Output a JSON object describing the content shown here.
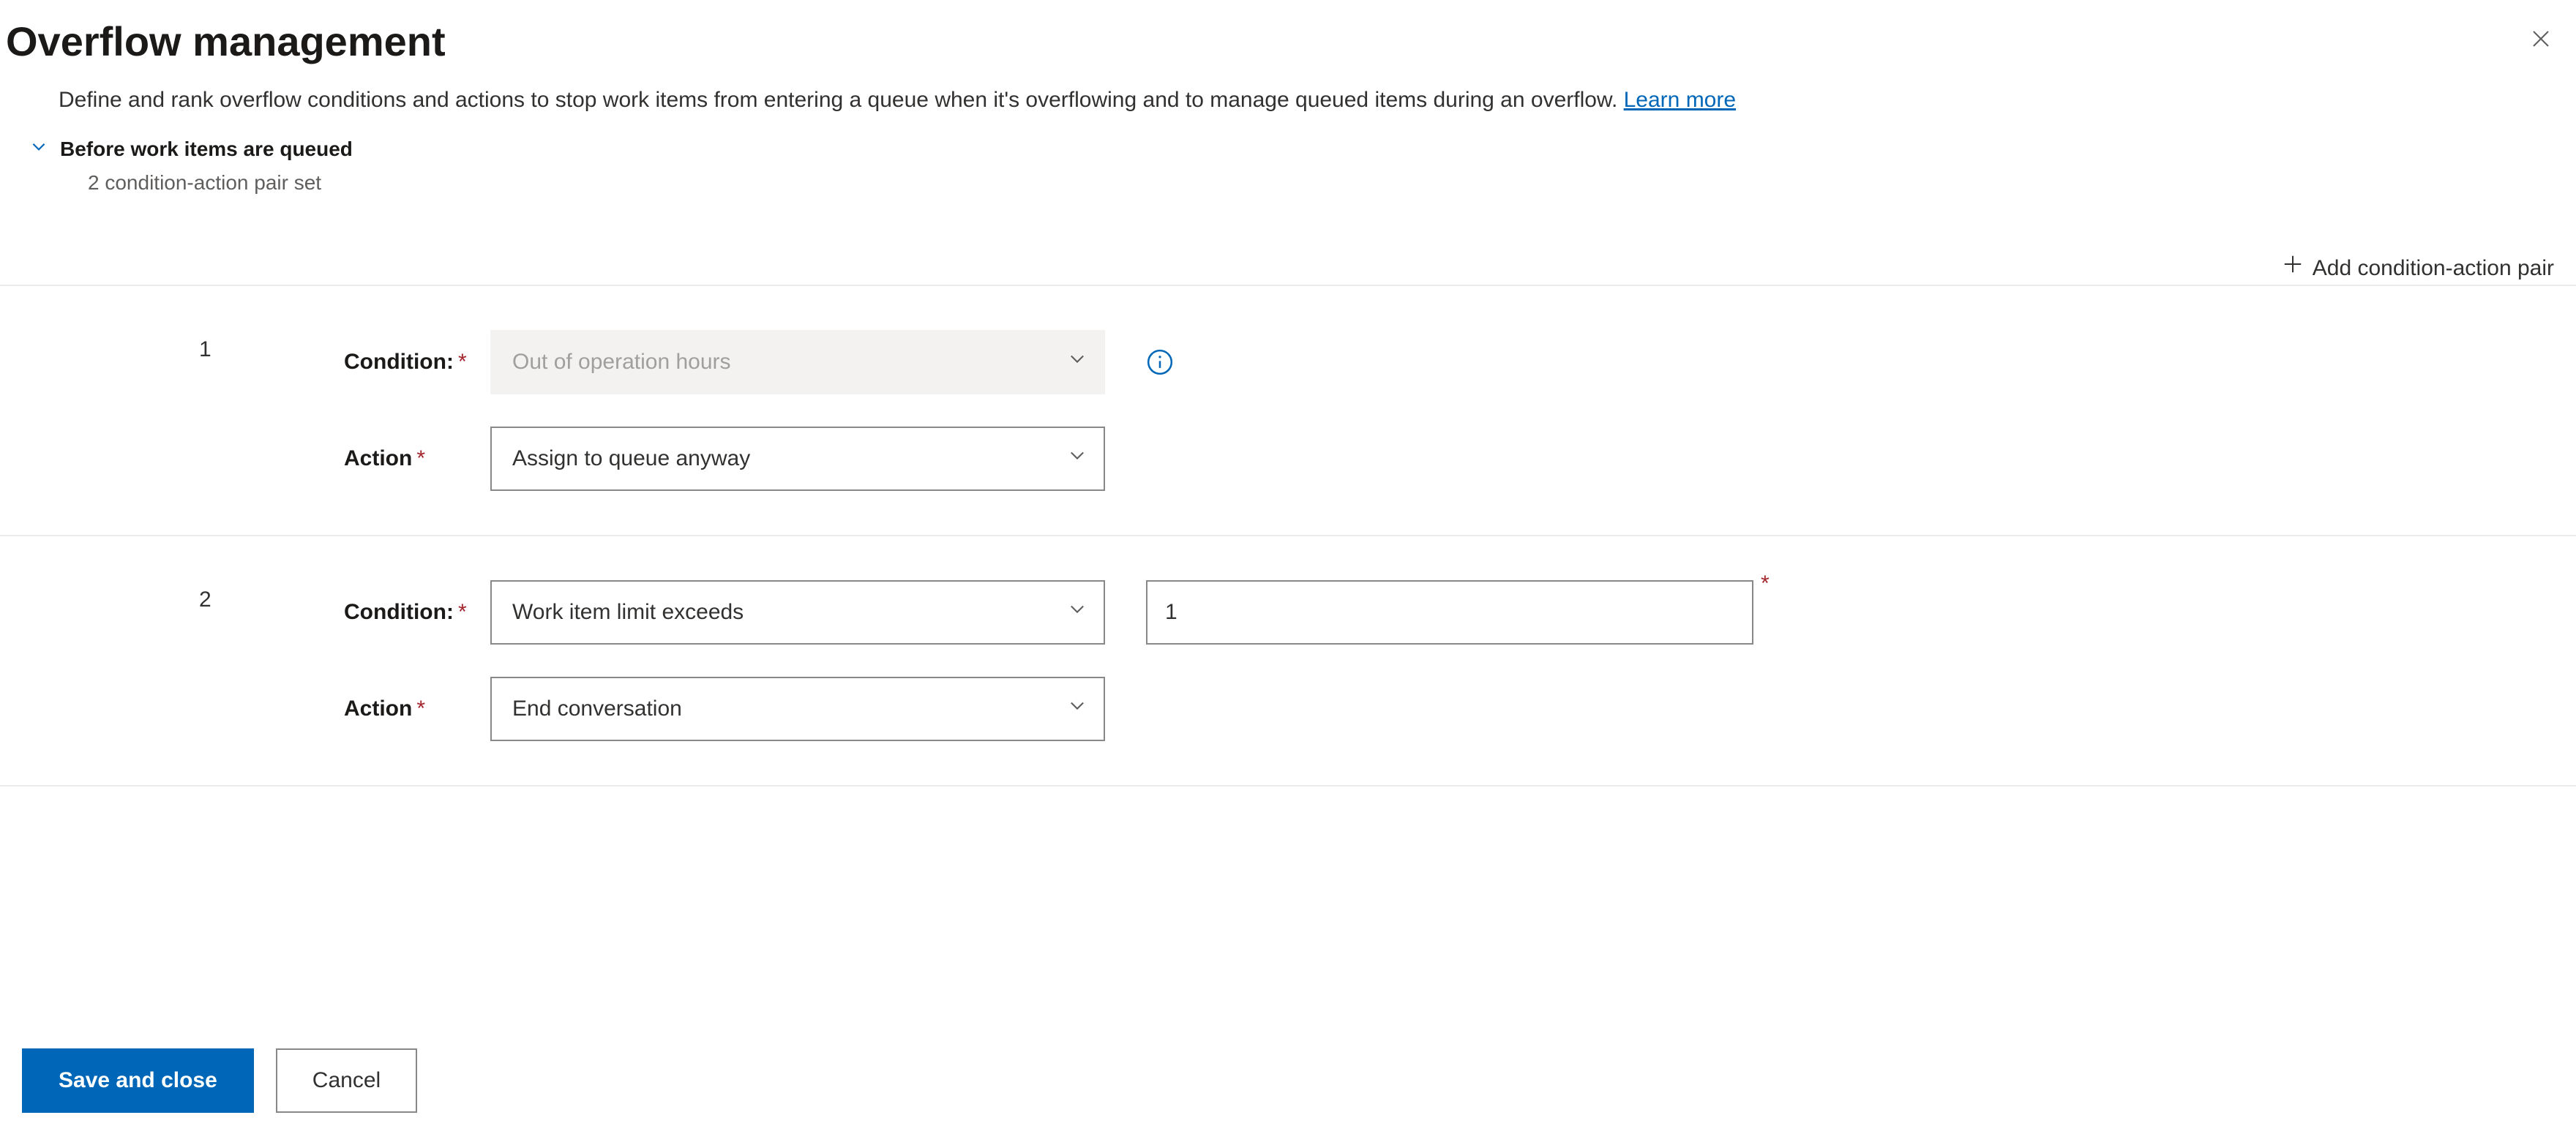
{
  "header": {
    "title": "Overflow management",
    "description": "Define and rank overflow conditions and actions to stop work items from entering a queue when it's overflowing and to manage queued items during an overflow. ",
    "learn_more": "Learn more"
  },
  "section": {
    "title": "Before work items are queued",
    "subtitle": "2 condition-action pair set",
    "add_button": "Add condition-action pair"
  },
  "labels": {
    "condition": "Condition:",
    "action": "Action"
  },
  "rules": [
    {
      "index": "1",
      "condition_value": "Out of operation hours",
      "condition_disabled": true,
      "extra_input": null,
      "action_value": "Assign to queue anyway",
      "show_info": true
    },
    {
      "index": "2",
      "condition_value": "Work item limit exceeds",
      "condition_disabled": false,
      "extra_input": "1",
      "action_value": "End conversation",
      "show_info": false
    }
  ],
  "footer": {
    "save": "Save and close",
    "cancel": "Cancel"
  }
}
